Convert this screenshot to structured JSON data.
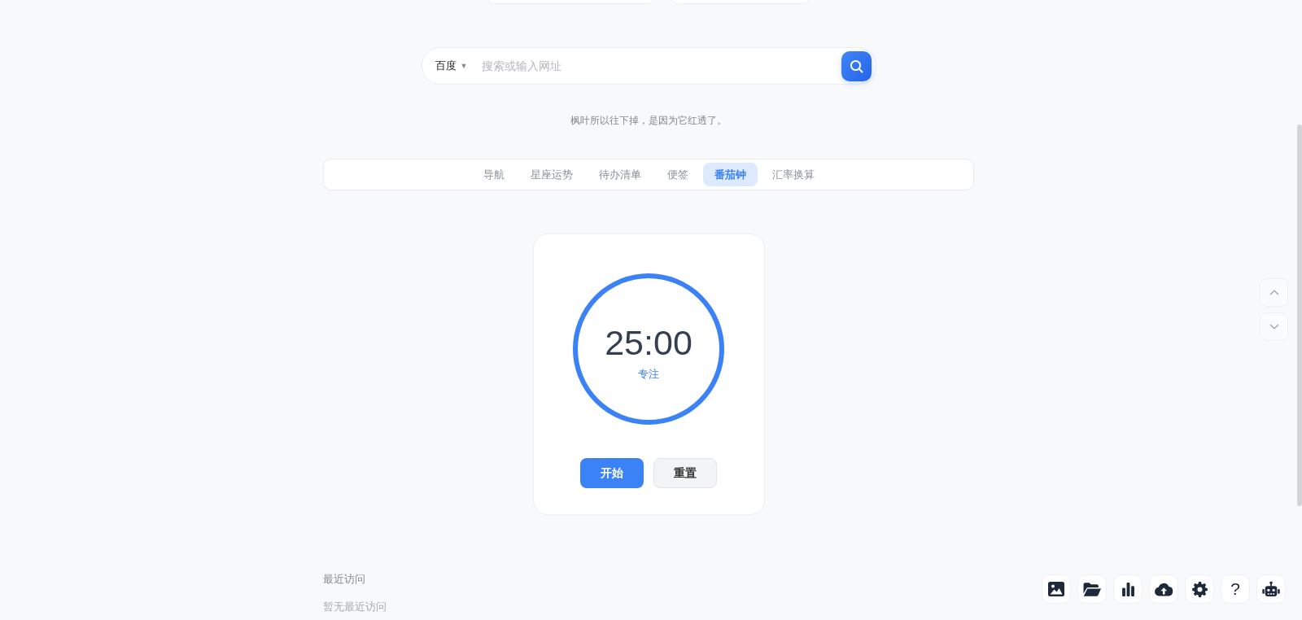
{
  "search": {
    "engine": "百度",
    "engine_caret": "▼",
    "placeholder": "搜索或输入网址"
  },
  "quote": "枫叶所以往下掉，是因为它红透了。",
  "tabs": [
    {
      "label": "导航",
      "selected": false
    },
    {
      "label": "星座运势",
      "selected": false
    },
    {
      "label": "待办清单",
      "selected": false
    },
    {
      "label": "便签",
      "selected": false
    },
    {
      "label": "番茄钟",
      "selected": true
    },
    {
      "label": "汇率换算",
      "selected": false
    }
  ],
  "pomodoro": {
    "time": "25:00",
    "mode": "专注",
    "level": 1,
    "buttons": [
      {
        "label": "开始",
        "kind": "primary"
      },
      {
        "label": "重置",
        "kind": "secondary"
      }
    ]
  },
  "recent": {
    "title": "最近访问",
    "empty_text": "暂无最近访问"
  },
  "toolbar": {
    "help_label": "?"
  }
}
